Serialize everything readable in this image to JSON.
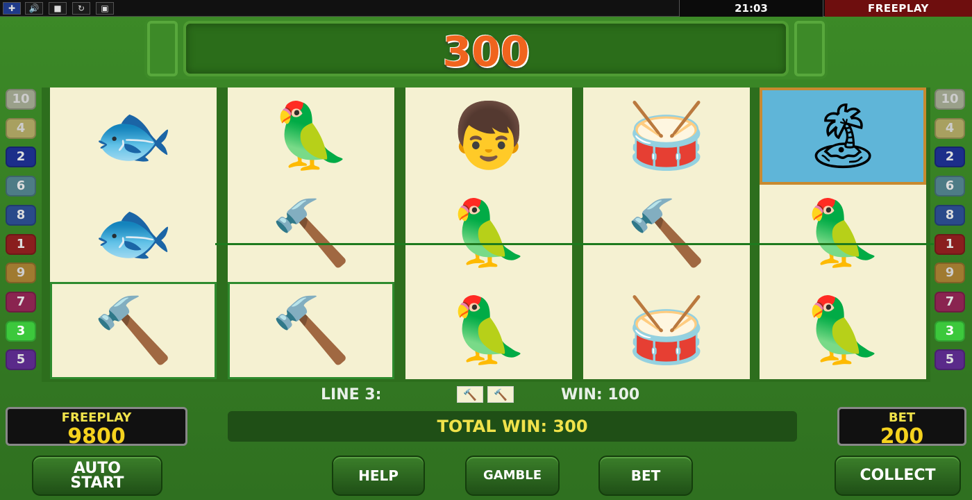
{
  "topbar": {
    "lang_icon": "uk-flag-icon",
    "sound_icon": "speaker-icon",
    "time": "21:03",
    "mode": "FREEPLAY"
  },
  "win_display": {
    "value": "300"
  },
  "line_numbers_left": [
    "10",
    "4",
    "2",
    "6",
    "8",
    "1",
    "9",
    "7",
    "3",
    "5"
  ],
  "line_numbers_right": [
    "10",
    "4",
    "2",
    "6",
    "8",
    "1",
    "9",
    "7",
    "3",
    "5"
  ],
  "line_colors": {
    "10": "#9aa08a",
    "4": "#a8a060",
    "2": "#1c2e8a",
    "6": "#4e7c86",
    "8": "#2a4a8a",
    "1": "#8a1e1e",
    "9": "#a07a30",
    "7": "#8a2450",
    "3": "#3cc83c",
    "5": "#5a2a8a"
  },
  "reels": [
    [
      "fish",
      "fish",
      "hammer"
    ],
    [
      "toucan",
      "hammer",
      "hammer"
    ],
    [
      "tribesman",
      "toucan",
      "toucan"
    ],
    [
      "drum",
      "hammer",
      "drum"
    ],
    [
      "island",
      "toucan",
      "toucan"
    ]
  ],
  "symbol_glyphs": {
    "fish": "🐟",
    "toucan": "🦜",
    "hammer": "🔨",
    "tribesman": "👦",
    "drum": "🥁",
    "island": "🏝"
  },
  "info": {
    "line_label": "LINE 3:",
    "win_label": "WIN: 100",
    "win_symbols": [
      "hammer",
      "hammer"
    ]
  },
  "credit": {
    "label": "FREEPLAY",
    "value": "9800"
  },
  "total_win": "TOTAL WIN: 300",
  "bet": {
    "label": "BET",
    "value": "200"
  },
  "buttons": {
    "auto_start": "AUTO\nSTART",
    "help": "HELP",
    "gamble": "GAMBLE",
    "bet": "BET",
    "collect": "COLLECT"
  }
}
